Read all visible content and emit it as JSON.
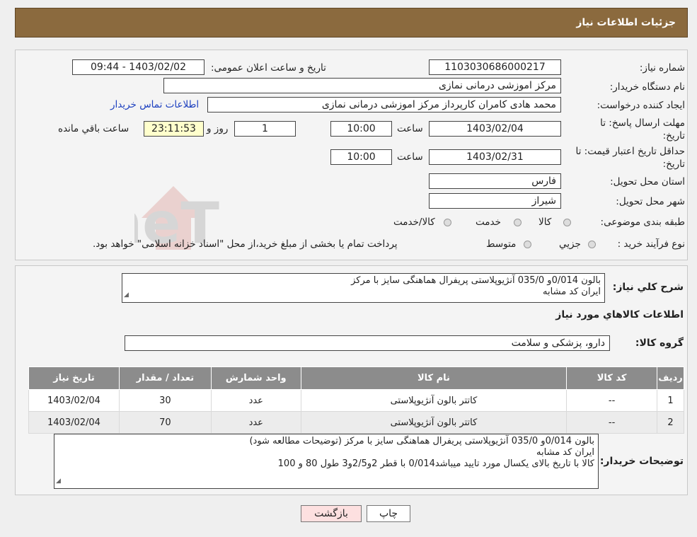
{
  "header": {
    "title": "جزئیات اطلاعات نیاز"
  },
  "watermark": {
    "text": "AriaTender.neT"
  },
  "form": {
    "need_number_label": "شماره نیاز:",
    "need_number": "1103030686000217",
    "announce_label": "تاریخ و ساعت اعلان عمومی:",
    "announce_value": "1403/02/02 - 09:44",
    "buyer_org_label": "نام دستگاه خریدار:",
    "buyer_org": "مرکز اموزشی درمانی نمازی",
    "creator_label": "ایجاد کننده درخواست:",
    "creator": "محمد هادی کامران کارپرداز مرکز اموزشی درمانی نمازی",
    "contact_link": "اطلاعات تماس خریدار",
    "deadline_label_1": "مهلت ارسال پاسخ: تا",
    "deadline_label_2": "تاریخ:",
    "deadline_date": "1403/02/04",
    "time_label": "ساعت",
    "deadline_time": "10:00",
    "days_value": "1",
    "days_label": "روز و",
    "remaining_time": "23:11:53",
    "remaining_label": "ساعت باقي مانده",
    "validity_label_1": "حداقل تاریخ اعتبار قیمت: تا",
    "validity_label_2": "تاریخ:",
    "validity_date": "1403/02/31",
    "validity_time": "10:00",
    "province_label": "استان محل تحویل:",
    "province": "فارس",
    "city_label": "شهر محل تحویل:",
    "city": "شیراز",
    "category_label": "طبقه بندی موضوعی:",
    "category_options": [
      "کالا",
      "خدمت",
      "کالا/خدمت"
    ],
    "process_label": "نوع فرآیند خرید :",
    "process_options": [
      "جزیي",
      "متوسط"
    ],
    "process_note": "پرداخت تمام یا بخشی از مبلغ خرید،از محل \"اسناد خزانه اسلامی\" خواهد بود."
  },
  "general": {
    "desc_label": "شرح کلي نياز:",
    "desc_line1": "بالون 0/014و 035/0 آنژیوپلاستی پریفرال هماهنگی سایز با مرکز",
    "desc_line2": "ایران کد مشابه",
    "items_title": "اطلاعات کالاهاي مورد نياز",
    "group_label": "گروه کالا:",
    "group_value": "دارو، پزشکی و سلامت"
  },
  "table": {
    "headers": [
      "رديف",
      "کد کالا",
      "نام کالا",
      "واحد شمارش",
      "تعداد / مقدار",
      "تاريخ نياز"
    ],
    "rows": [
      [
        "1",
        "--",
        "کاتتر بالون آنژیوپلاستی",
        "عدد",
        "30",
        "1403/02/04"
      ],
      [
        "2",
        "--",
        "کاتتر بالون آنژیوپلاستی",
        "عدد",
        "70",
        "1403/02/04"
      ]
    ]
  },
  "buyer_notes": {
    "label": "توضیحات خریدار:",
    "line1": "بالون 0/014و 035/0 آنژیوپلاستی پریفرال هماهنگی سایز با مرکز (توضیحات مطالعه شود)",
    "line2": "ایران کد مشابه",
    "line3": "کالا با تاریخ بالای یکسال مورد تایید میباشد0/014 با   قطر 2و2/5و3 طول 80  و  100"
  },
  "buttons": {
    "print": "چاپ",
    "back": "بازگشت"
  }
}
